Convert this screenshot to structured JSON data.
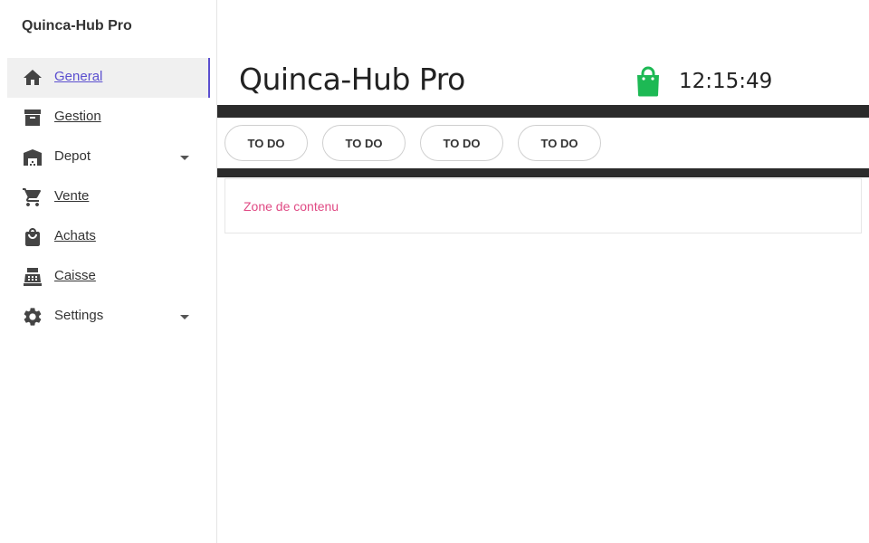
{
  "brand": "Quinca-Hub Pro",
  "sidebar": {
    "items": [
      {
        "label": "General",
        "icon": "home-icon",
        "active": true
      },
      {
        "label": "Gestion",
        "icon": "archive-icon"
      },
      {
        "label": "Depot",
        "icon": "warehouse-icon",
        "expandable": true
      },
      {
        "label": "Vente",
        "icon": "cart-icon"
      },
      {
        "label": "Achats",
        "icon": "shopping-bag-icon"
      },
      {
        "label": "Caisse",
        "icon": "cash-register-icon"
      },
      {
        "label": "Settings",
        "icon": "gear-icon",
        "expandable": true
      }
    ]
  },
  "header": {
    "title": "Quinca-Hub Pro",
    "clock": "12:15:49",
    "bag_icon": "shopping-bag-icon"
  },
  "tabs": [
    {
      "label": "TO DO"
    },
    {
      "label": "TO DO"
    },
    {
      "label": "TO DO"
    },
    {
      "label": "TO DO"
    }
  ],
  "content": {
    "text": "Zone de contenu"
  },
  "colors": {
    "accent": "#5b4fcf",
    "bag": "#1db954",
    "content_text": "#e04a84",
    "bar": "#2b2b2b"
  }
}
